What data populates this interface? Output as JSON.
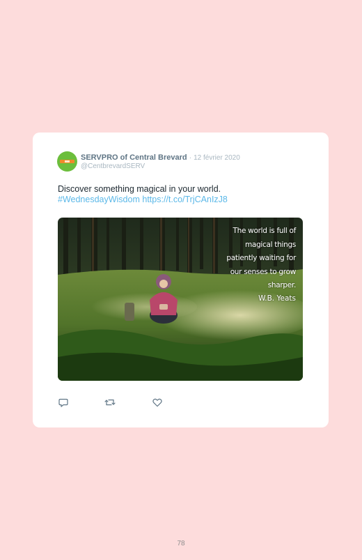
{
  "tweet": {
    "author_name": "SERVPRO of Central Brevard",
    "date_separator": "·",
    "date": "12 février 2020",
    "handle": "@CentbrevardSERV",
    "text": "Discover something magical in your world.",
    "hashtag": "#WednesdayWisdom",
    "link": "https://t.co/TrjCAnIzJ8",
    "avatar_text": "SERVPRO",
    "image": {
      "quote_lines": [
        "The world is full of",
        "magical things",
        "patiently waiting for",
        "our senses to grow",
        "sharper."
      ],
      "quote_author": "W.B. Yeats"
    },
    "actions": {
      "reply_icon": "reply-icon",
      "retweet_icon": "retweet-icon",
      "like_icon": "heart-icon"
    }
  },
  "page_number": "78",
  "colors": {
    "background": "#fddcdc",
    "card": "#ffffff",
    "link": "#5bb8e8",
    "author": "#5f7585",
    "muted": "#a9b7c1",
    "brand_green": "#6cbe3c",
    "brand_orange": "#f08a2a"
  }
}
